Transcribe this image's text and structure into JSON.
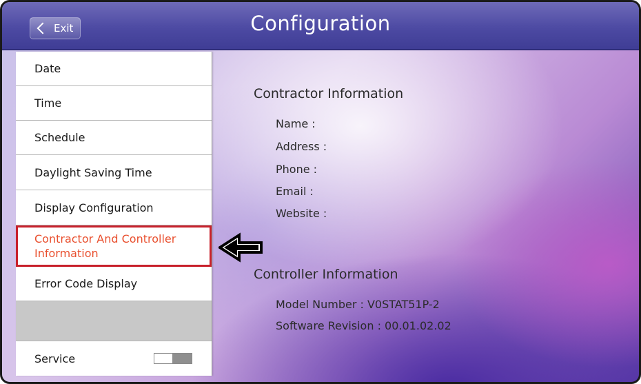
{
  "header": {
    "exit_label": "Exit",
    "title": "Configuration"
  },
  "sidebar": {
    "items": [
      {
        "label": "Date"
      },
      {
        "label": "Time"
      },
      {
        "label": "Schedule"
      },
      {
        "label": "Daylight Saving Time"
      },
      {
        "label": "Display Configuration"
      },
      {
        "label": "Contractor And Controller Information",
        "state": "selected"
      },
      {
        "label": "Error Code Display"
      }
    ],
    "service": {
      "label": "Service",
      "toggle_state": "off"
    }
  },
  "contractor_info": {
    "heading": "Contractor Information",
    "fields": [
      "Name :",
      "Address :",
      "Phone :",
      "Email :",
      "Website :"
    ]
  },
  "controller_info": {
    "heading": "Controller Information",
    "model_number": "Model Number : V0STAT51P-2",
    "software_revision": "Software Revision : 00.01.02.02"
  },
  "colors": {
    "header_accent": "#4d4aa3",
    "selected_text": "#e9502f",
    "selected_border": "#c8202b"
  },
  "icons": {
    "exit": "chevron-left-icon",
    "pointer": "arrow-left-icon"
  }
}
